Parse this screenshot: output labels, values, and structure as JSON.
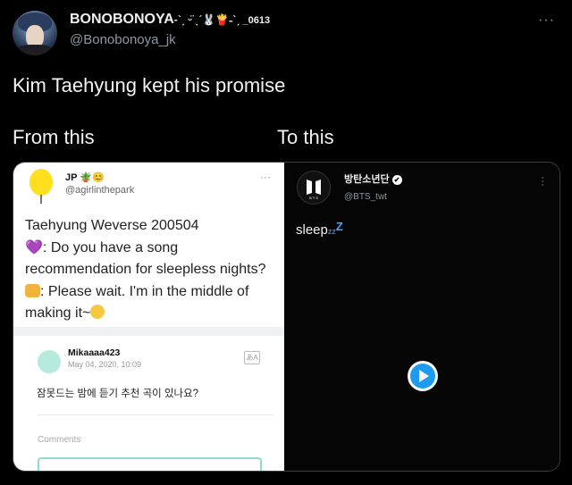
{
  "tweet": {
    "display_name": "BONOBONOYA",
    "display_suffix": "_0613",
    "handle": "@Bonobonoya_jk",
    "text": "Kim Taehyung kept his promise",
    "more": "···"
  },
  "captions": {
    "from": "From this",
    "to": "To this"
  },
  "left_panel": {
    "user_name": "JP",
    "user_handle": "@agirlinthepark",
    "more": "···",
    "lines": [
      "Taehyung Weverse 200504",
      ": Do you have a song",
      "recommendation for sleepless nights?",
      ": Please wait. I'm in the middle of",
      "making it~"
    ],
    "comment": {
      "name": "Mikaaaa423",
      "date": "May 04, 2020, 10:09",
      "text": "잠못드는 밤에 듣기 추천 곡이 있나요?"
    },
    "comments_label": "Comments"
  },
  "right_panel": {
    "name": "방탄소년단",
    "handle": "@BTS_twt",
    "text": "sleep",
    "zz": "zz",
    "Z": "Z"
  },
  "colors": {
    "background": "#000000",
    "text": "#e7e9ea",
    "muted": "#8b98a5",
    "accent": "#1d9bf0"
  }
}
